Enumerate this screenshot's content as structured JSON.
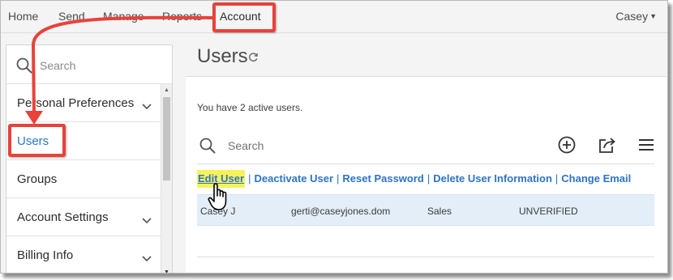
{
  "topnav": {
    "items": [
      {
        "label": "Home"
      },
      {
        "label": "Send"
      },
      {
        "label": "Manage"
      },
      {
        "label": "Reports"
      },
      {
        "label": "Account",
        "active": true
      }
    ],
    "user_menu": {
      "label": "Casey",
      "icon": "chevron-down-icon"
    }
  },
  "sidebar": {
    "search": {
      "placeholder": "Search",
      "icon": "search-icon"
    },
    "items": [
      {
        "label": "Personal Preferences",
        "expandable": true
      },
      {
        "label": "Users",
        "active": true,
        "expandable": false
      },
      {
        "label": "Groups",
        "expandable": false
      },
      {
        "label": "Account Settings",
        "expandable": true
      },
      {
        "label": "Billing Info",
        "expandable": true
      }
    ]
  },
  "main": {
    "title": "Users",
    "title_icon": "refresh-icon",
    "active_users_text": "You have 2 active users.",
    "search": {
      "placeholder": "Search",
      "icon": "search-icon"
    },
    "toolbar_icons": [
      "add-circle-icon",
      "share-icon",
      "menu-icon"
    ],
    "actions": [
      {
        "label": "Edit User"
      },
      {
        "label": "Deactivate User"
      },
      {
        "label": "Reset Password"
      },
      {
        "label": "Delete User Information"
      },
      {
        "label": "Change Email"
      }
    ],
    "action_separator": "|",
    "rows": [
      {
        "name": "Casey J",
        "email": "gerti@caseyjones.dom",
        "department": "Sales",
        "status": "UNVERIFIED"
      }
    ]
  },
  "annotations": {
    "highlight_color": "#e8423b",
    "marker_color": "#f7f25c",
    "cursor_icon": "hand-pointer-icon"
  },
  "colors": {
    "accent": "#2b74c8",
    "selected_row": "#e3eef8",
    "background": "#f4f4f4"
  }
}
